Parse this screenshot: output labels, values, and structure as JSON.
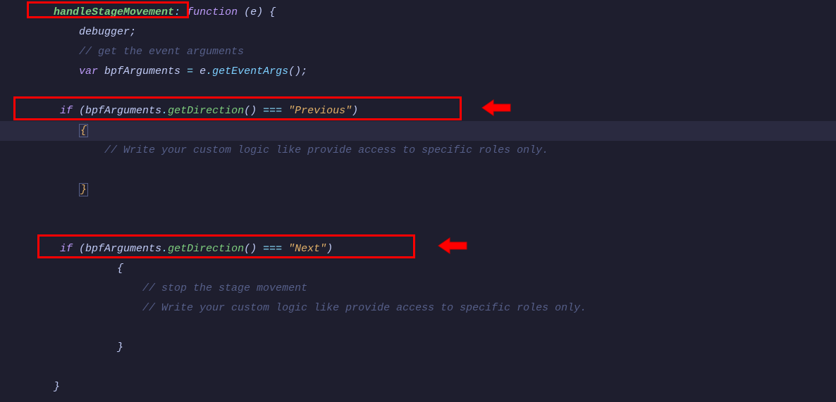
{
  "code": {
    "line1": {
      "indent": "    ",
      "fname": "handleStageMovement",
      "colon": ": ",
      "keyword": "function",
      "params": " (",
      "param": "e",
      "rparen": ") ",
      "brace": "{"
    },
    "line2": {
      "indent": "        ",
      "keyword": "debugger",
      "semi": ";"
    },
    "line3": {
      "indent": "        ",
      "comment": "// get the event arguments"
    },
    "line4": {
      "indent": "        ",
      "var": "var ",
      "ident": "bpfArguments",
      "eq": " = ",
      "obj": "e",
      "dot": ".",
      "method": "getEventArgs",
      "parens": "()",
      "semi": ";"
    },
    "line5": {
      "indent": "     ",
      "if": "if ",
      "lparen": "(",
      "ident": "bpfArguments",
      "dot": ".",
      "method": "getDirection",
      "parens": "()",
      "op": " === ",
      "string": "\"Previous\"",
      "rparen": ")"
    },
    "line6": {
      "indent": "        ",
      "brace": "{"
    },
    "line7": {
      "indent": "            ",
      "comment": "// Write your custom logic like provide access to specific roles only."
    },
    "line8": {
      "indent": "        ",
      "brace": "}"
    },
    "line9": {
      "indent": "     ",
      "if": "if ",
      "lparen": "(",
      "ident": "bpfArguments",
      "dot": ".",
      "method": "getDirection",
      "parens": "()",
      "op": " === ",
      "string": "\"Next\"",
      "rparen": ")"
    },
    "line10": {
      "indent": "              ",
      "brace": "{"
    },
    "line11": {
      "indent": "                  ",
      "comment": "// stop the stage movement"
    },
    "line12": {
      "indent": "                  ",
      "comment": "// Write your custom logic like provide access to specific roles only."
    },
    "line13": {
      "indent": "              ",
      "brace": "}"
    },
    "line14": {
      "indent": "    ",
      "brace": "}"
    }
  },
  "annotations": {
    "box1_label": "handleStageMovement highlight",
    "box2_label": "Previous condition highlight",
    "box3_label": "Next condition highlight",
    "arrow1_label": "arrow pointing to Previous condition",
    "arrow2_label": "arrow pointing to Next condition"
  }
}
